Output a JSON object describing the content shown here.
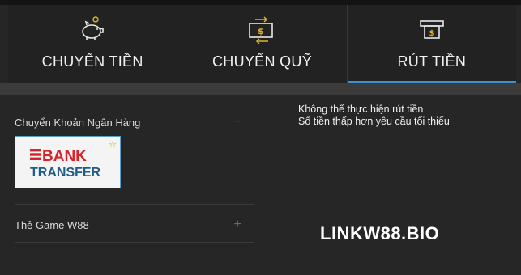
{
  "tabs": [
    {
      "label": "CHUYỂN TIỀN",
      "icon": "piggy-bank-icon",
      "active": false
    },
    {
      "label": "CHUYỂN QUỸ",
      "icon": "fund-transfer-icon",
      "active": false
    },
    {
      "label": "RÚT TIỀN",
      "icon": "cash-withdraw-icon",
      "active": true
    }
  ],
  "methods": [
    {
      "label": "Chuyển Khoản Ngân Hàng",
      "toggle": "−",
      "expanded": true
    },
    {
      "label": "Thẻ Game W88",
      "toggle": "+",
      "expanded": false
    }
  ],
  "bank_card": {
    "line1": "BANK",
    "line2": "TRANSFER"
  },
  "notice": {
    "line1": "Không thể thực hiện rút tiền",
    "line2": "Số tiền thấp hơn yêu cầu tối thiểu"
  },
  "watermark": "LINKW88.BIO",
  "colors": {
    "accent": "#3d8fd1",
    "icon_gold": "#e0b12c",
    "bank_red": "#d8222a",
    "bank_blue": "#1f5d86"
  }
}
